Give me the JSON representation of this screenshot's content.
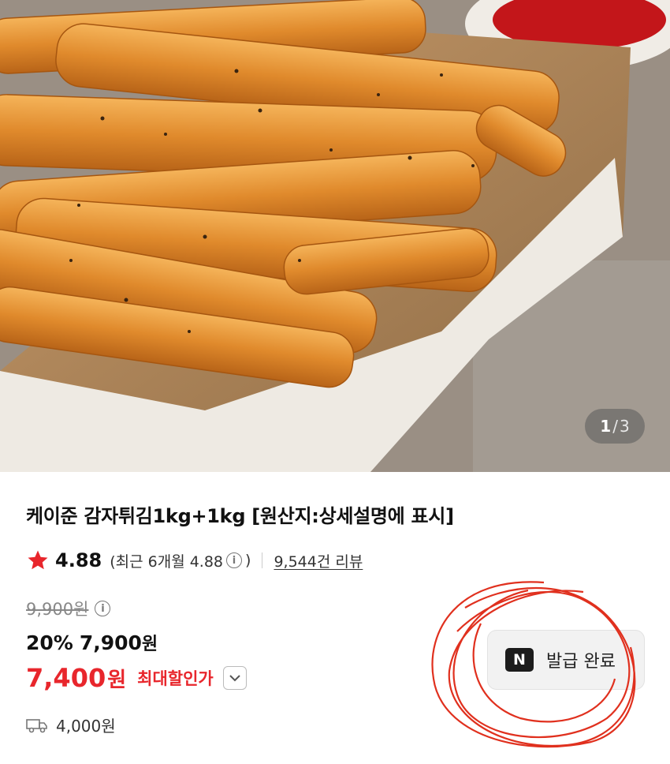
{
  "gallery": {
    "image_icon": "french-fries-photo",
    "current": "1",
    "separator": "/",
    "total": "3"
  },
  "product": {
    "title": "케이준 감자튀김1kg+1kg [원산지:상세설명에 표시]"
  },
  "rating": {
    "star_icon": "star-icon",
    "score": "4.88",
    "recent_label": "(최근 6개월 4.88",
    "recent_close": ")",
    "info_glyph": "i",
    "review_count": "9,544건 리뷰"
  },
  "pricing": {
    "original_price": "9,900원",
    "discount_percent": "20%",
    "sale_price": "7,900",
    "sale_unit": "원",
    "max_discount_price": "7,400",
    "max_discount_unit": "원",
    "max_discount_label": "최대할인가"
  },
  "shipping": {
    "icon": "truck-icon",
    "fee": "4,000원"
  },
  "coupon": {
    "badge": "N",
    "label": "발급 완료"
  },
  "colors": {
    "accent_red": "#e8262c",
    "star": "#e8262c",
    "annotation": "#e0301e"
  }
}
